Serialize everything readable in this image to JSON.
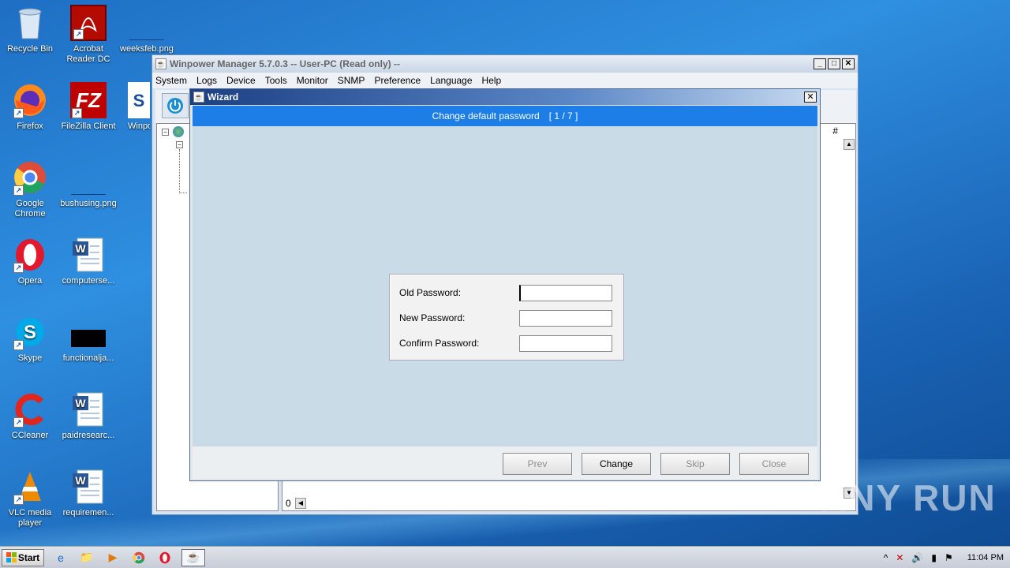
{
  "desktop": {
    "icons": [
      {
        "label": "Recycle Bin",
        "icon": "recycle-bin-icon"
      },
      {
        "label": "Acrobat Reader DC",
        "icon": "acrobat-icon"
      },
      {
        "label": "weeksfeb.png",
        "icon": "image-file-icon"
      },
      {
        "label": "Firefox",
        "icon": "firefox-icon"
      },
      {
        "label": "FileZilla Client",
        "icon": "filezilla-icon"
      },
      {
        "label": "Winpo",
        "icon": "winpower-icon"
      },
      {
        "label": "Google Chrome",
        "icon": "chrome-icon"
      },
      {
        "label": "bushusing.png",
        "icon": "image-file-icon"
      },
      {
        "label": "Opera",
        "icon": "opera-icon"
      },
      {
        "label": "computerse...",
        "icon": "word-doc-icon"
      },
      {
        "label": "Skype",
        "icon": "skype-icon"
      },
      {
        "label": "functionalja...",
        "icon": "image-file-icon"
      },
      {
        "label": "CCleaner",
        "icon": "ccleaner-icon"
      },
      {
        "label": "paidresearc...",
        "icon": "word-doc-icon"
      },
      {
        "label": "VLC media player",
        "icon": "vlc-icon"
      },
      {
        "label": "requiremen...",
        "icon": "word-doc-icon"
      }
    ]
  },
  "main_window": {
    "title": "Winpower Manager 5.7.0.3 -- User-PC (Read only) --",
    "menu": [
      "System",
      "Logs",
      "Device",
      "Tools",
      "Monitor",
      "SNMP",
      "Preference",
      "Language",
      "Help"
    ],
    "right_pane_header": "#",
    "status_value": "0"
  },
  "wizard": {
    "title": "Wizard",
    "step_title": "Change default password",
    "step_counter": "[ 1 / 7 ]",
    "fields": {
      "old_password_label": "Old Password:",
      "new_password_label": "New Password:",
      "confirm_password_label": "Confirm Password:",
      "old_password_value": "",
      "new_password_value": "",
      "confirm_password_value": ""
    },
    "buttons": {
      "prev": "Prev",
      "change": "Change",
      "skip": "Skip",
      "close": "Close"
    }
  },
  "taskbar": {
    "start_label": "Start",
    "clock": "11:04 PM"
  },
  "watermark": "ANY RUN",
  "colors": {
    "wizard_header": "#1c7ee6",
    "wizard_body": "#c9dbe6",
    "desktop": "#2f8fe0"
  }
}
